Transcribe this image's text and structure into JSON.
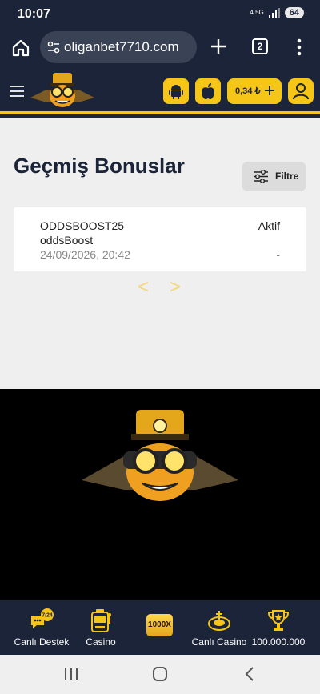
{
  "status_bar": {
    "time": "10:07",
    "network": "4.5G",
    "battery": "64"
  },
  "browser": {
    "url": "oliganbet7710.com",
    "tab_count": "2"
  },
  "site_header": {
    "balance": "0,34 ₺"
  },
  "main": {
    "title": "Geçmiş Bonuslar",
    "filter_label": "Filtre",
    "bonuses": [
      {
        "code": "ODDSBOOST25",
        "type": "oddsBoost",
        "date": "24/09/2026, 20:42",
        "status": "Aktif",
        "amount": "-"
      }
    ],
    "pager": {
      "prev": "<",
      "next": ">"
    }
  },
  "bottom_nav": {
    "support": "Canlı Destek",
    "support_badge": "7/24",
    "casino": "Casino",
    "x1000": "1000X",
    "live_casino": "Canlı Casino",
    "prize": "100.000.000"
  },
  "colors": {
    "accent": "#f5c518",
    "header_bg": "#1b2438",
    "page_bg": "#efefef"
  }
}
